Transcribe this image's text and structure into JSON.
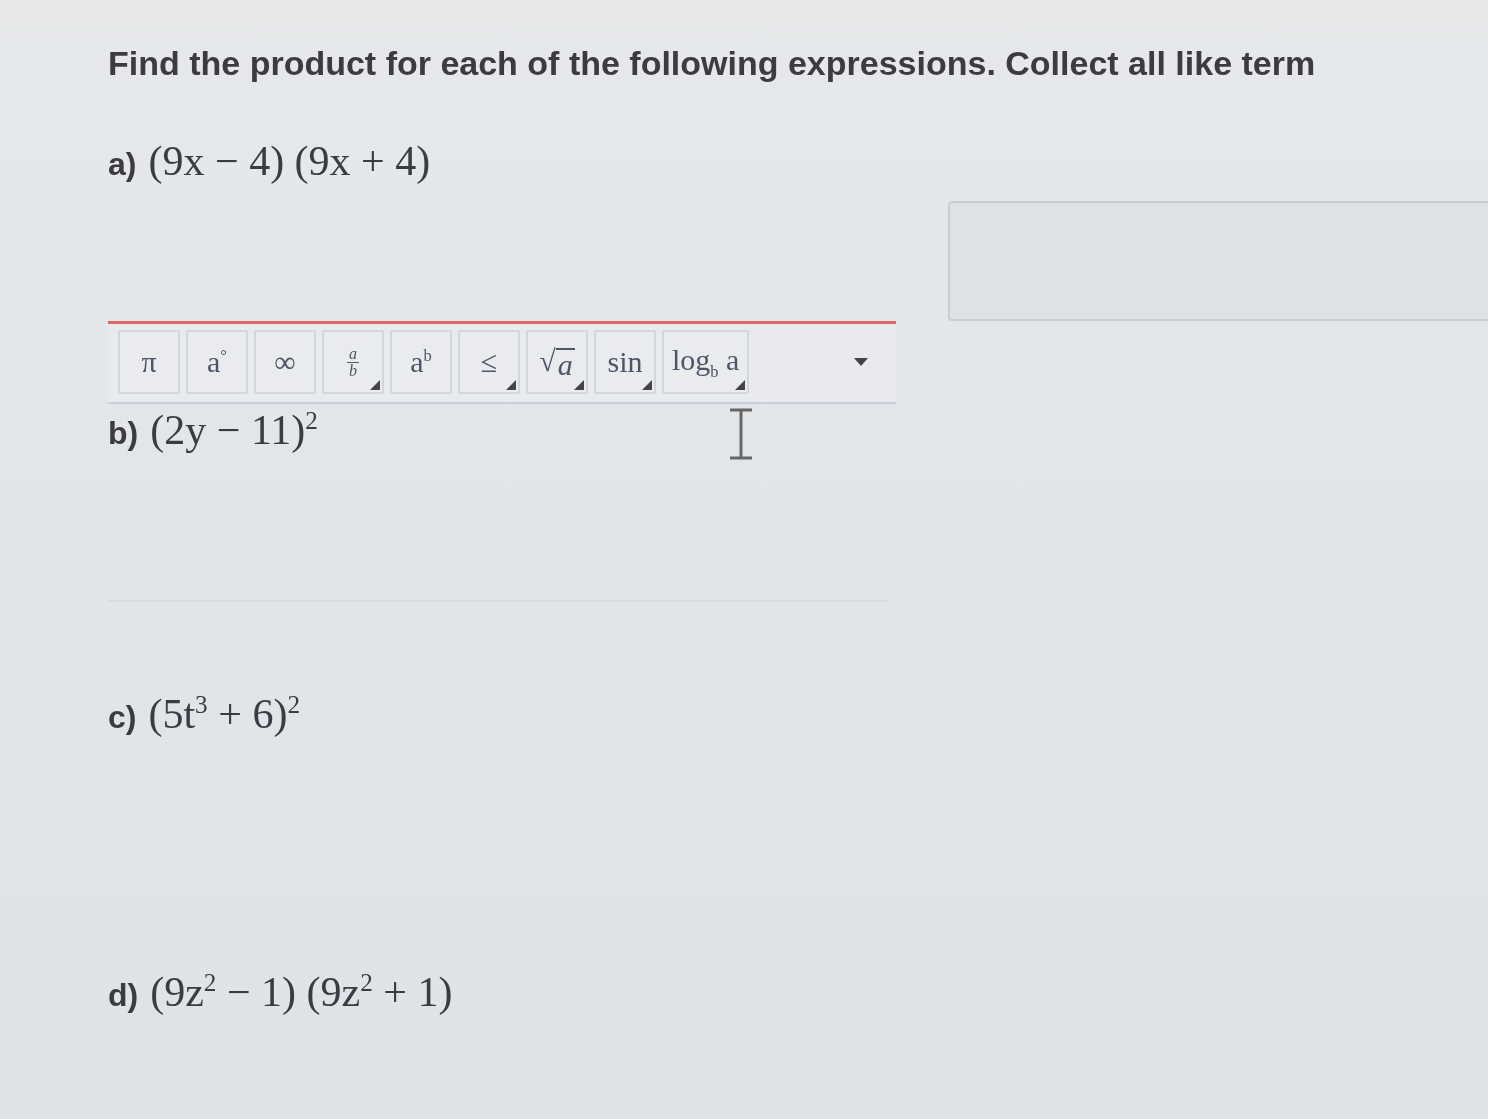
{
  "instruction": "Find the product for each of the following expressions. Collect all like term",
  "toolbar": {
    "buttons": [
      {
        "kind": "text",
        "label": "π",
        "has_menu": false
      },
      {
        "kind": "text",
        "label": "a$^{°}$",
        "has_menu": false
      },
      {
        "kind": "text",
        "label": "∞",
        "has_menu": false
      },
      {
        "kind": "fraction",
        "numerator": "a",
        "denominator": "b",
        "has_menu": true
      },
      {
        "kind": "text",
        "label": "a$^{b}$",
        "has_menu": false
      },
      {
        "kind": "text",
        "label": "≤",
        "has_menu": true
      },
      {
        "kind": "root",
        "symbol": "√",
        "label": "a",
        "has_menu": true
      },
      {
        "kind": "text",
        "label": "sin",
        "has_menu": true
      },
      {
        "kind": "text",
        "label": "log$_{b}$ a",
        "has_menu": true
      }
    ]
  },
  "questions": [
    {
      "label": "a)",
      "expression": "(9x − 4) (9x + 4)"
    },
    {
      "label": "b)",
      "expression": "(2y − 11)$^{2}$"
    },
    {
      "label": "c)",
      "expression": "(5t$^{3}$ + 6)$^{2}$"
    },
    {
      "label": "d)",
      "expression": "(9z$^{2}$ − 1) (9z$^{2}$ + 1)"
    }
  ]
}
